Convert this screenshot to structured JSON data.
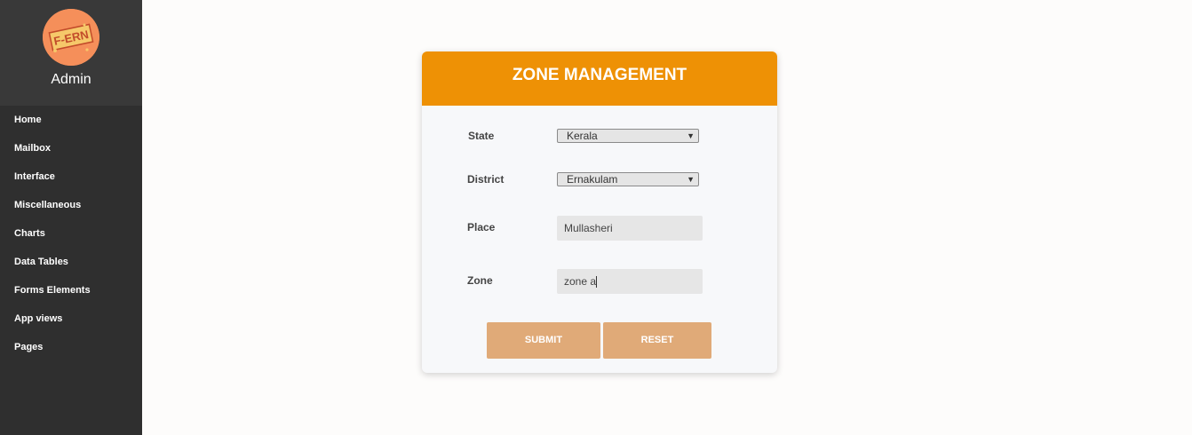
{
  "sidebar": {
    "logo_text": "F-ERN",
    "admin_name": "Admin",
    "items": [
      {
        "label": "Home"
      },
      {
        "label": "Mailbox"
      },
      {
        "label": "Interface"
      },
      {
        "label": "Miscellaneous"
      },
      {
        "label": "Charts"
      },
      {
        "label": "Data Tables"
      },
      {
        "label": "Forms Elements"
      },
      {
        "label": "App views"
      },
      {
        "label": "Pages"
      }
    ]
  },
  "form": {
    "title": "ZONE MANAGEMENT",
    "state_label": "State",
    "state_value": "Kerala",
    "district_label": "District",
    "district_value": "Ernakulam",
    "place_label": "Place",
    "place_value": "Mullasheri",
    "zone_label": "Zone",
    "zone_value": "zone a",
    "submit_label": "SUBMIT",
    "reset_label": "RESET"
  },
  "colors": {
    "sidebar_bg": "#2f2f2f",
    "header_orange": "#ee9105",
    "button_bg": "#e0aa78",
    "avatar_bg": "#f58f5a"
  }
}
